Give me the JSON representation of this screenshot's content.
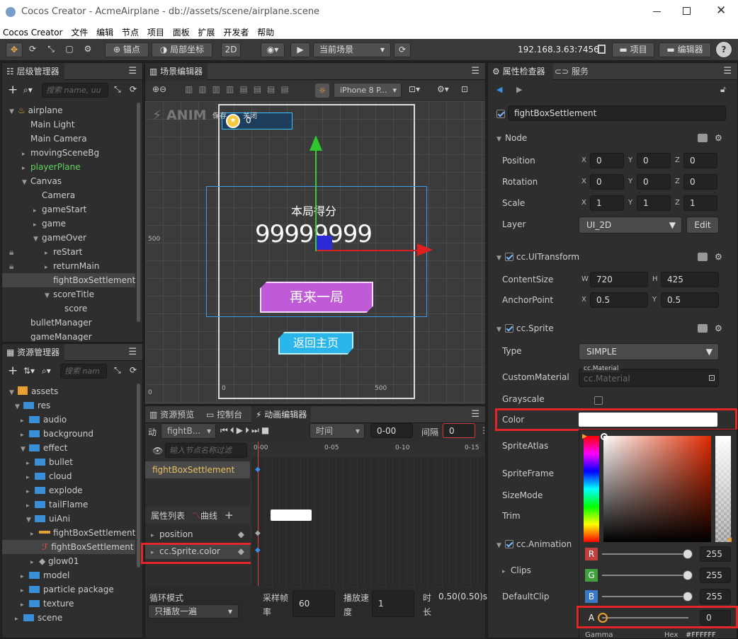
{
  "window": {
    "title": "Cocos Creator - AcmeAirplane - db://assets/scene/airplane.scene"
  },
  "menu": [
    "Cocos Creator",
    "文件",
    "编辑",
    "节点",
    "项目",
    "面板",
    "扩展",
    "开发者",
    "帮助"
  ],
  "toolbar": {
    "anchor": "锚点",
    "local": "局部坐标",
    "mode2d": "2D",
    "scene_select": "当前场景",
    "ip": "192.168.3.63:7456",
    "project": "项目",
    "editor": "编辑器",
    "help": "?"
  },
  "hierarchy": {
    "title": "层级管理器",
    "search_placeholder": "搜索 name, uu",
    "items": [
      {
        "label": "airplane"
      },
      {
        "label": "Main Light"
      },
      {
        "label": "Main Camera"
      },
      {
        "label": "movingSceneBg"
      },
      {
        "label": "playerPlane"
      },
      {
        "label": "Canvas"
      },
      {
        "label": "Camera"
      },
      {
        "label": "gameStart"
      },
      {
        "label": "game"
      },
      {
        "label": "gameOver"
      },
      {
        "label": "reStart"
      },
      {
        "label": "returnMain"
      },
      {
        "label": "fightBoxSettlement"
      },
      {
        "label": "scoreTitle"
      },
      {
        "label": "score"
      },
      {
        "label": "bulletManager"
      },
      {
        "label": "gameManager"
      }
    ]
  },
  "assets": {
    "title": "资源管理器",
    "search_placeholder": "搜索 nam",
    "items": [
      {
        "label": "assets"
      },
      {
        "label": "res"
      },
      {
        "label": "audio"
      },
      {
        "label": "background"
      },
      {
        "label": "effect"
      },
      {
        "label": "bullet"
      },
      {
        "label": "cloud"
      },
      {
        "label": "explode"
      },
      {
        "label": "tailFlame"
      },
      {
        "label": "uiAni"
      },
      {
        "label": "fightBoxSettlement"
      },
      {
        "label": "fightBoxSettlement"
      },
      {
        "label": "glow01"
      },
      {
        "label": "model"
      },
      {
        "label": "particle package"
      },
      {
        "label": "texture"
      },
      {
        "label": "scene"
      }
    ]
  },
  "scene": {
    "title": "场景编辑器",
    "device": "iPhone 8 P...",
    "anim_label": "ANIM",
    "save": "保存",
    "close": "关闭",
    "coin_count": "0",
    "score_title": "本局得分",
    "score": "99999999",
    "replay": "再来一局",
    "home": "返回主页",
    "ruler_500": "500",
    "ruler_0": "0",
    "ruler_x0": "0",
    "ruler_x500": "500"
  },
  "bottom_tabs": {
    "preview": "资源预览",
    "console": "控制台",
    "anim": "动画编辑器"
  },
  "anim": {
    "label": "动",
    "clip": "fightB...",
    "time_mode": "时间",
    "time": "0-00",
    "interval_label": "间隔",
    "interval": "0",
    "filter_placeholder": "输入节点名称过滤",
    "ticks": [
      "0-00",
      "0-05",
      "0-10",
      "0-15"
    ],
    "node": "fightBoxSettlement",
    "props_label": "属性列表",
    "curve_label": "曲线",
    "props": [
      "position",
      "cc.Sprite.color"
    ],
    "loop_label": "循环模式",
    "loop": "只播放一遍",
    "sample_label_1": "采样帧",
    "sample_label_2": "率",
    "sample": "60",
    "speed_label_1": "播放速",
    "speed_label_2": "度",
    "speed": "1",
    "duration_label_1": "时",
    "duration_label_2": "长",
    "duration": "0.50(0.50)s"
  },
  "inspector": {
    "tab1": "属性检查器",
    "tab2": "服务",
    "node_name": "fightBoxSettlement",
    "node_section": "Node",
    "position": {
      "label": "Position",
      "x": "0",
      "y": "0",
      "z": "0"
    },
    "rotation": {
      "label": "Rotation",
      "x": "0",
      "y": "0",
      "z": "0"
    },
    "scale": {
      "label": "Scale",
      "x": "1",
      "y": "1",
      "z": "1"
    },
    "layer": {
      "label": "Layer",
      "value": "UI_2D",
      "edit": "Edit"
    },
    "uitransform": "cc.UITransform",
    "content_size": {
      "label": "ContentSize",
      "w": "720",
      "h": "425"
    },
    "anchor_point": {
      "label": "AnchorPoint",
      "x": "0.5",
      "y": "0.5"
    },
    "sprite": "cc.Sprite",
    "type": {
      "label": "Type",
      "value": "SIMPLE"
    },
    "custom_material": {
      "label": "CustomMaterial",
      "tag": "cc.Material",
      "placeholder": "cc.Material"
    },
    "grayscale": "Grayscale",
    "color": "Color",
    "sprite_atlas": "SpriteAtlas",
    "sprite_frame": "SpriteFrame",
    "size_mode": "SizeMode",
    "trim": "Trim",
    "animation": "cc.Animation",
    "clips": "Clips",
    "default_clip": "DefaultClip",
    "axis": {
      "x": "X",
      "y": "Y",
      "z": "Z",
      "w": "W",
      "h": "H"
    }
  },
  "color_picker": {
    "r": "255",
    "g": "255",
    "b": "255",
    "a": "0",
    "labels": {
      "r": "R",
      "g": "G",
      "b": "B",
      "a": "A"
    },
    "gamma": "Gamma",
    "hex_label": "Hex",
    "hex": "#FFFFFF"
  }
}
